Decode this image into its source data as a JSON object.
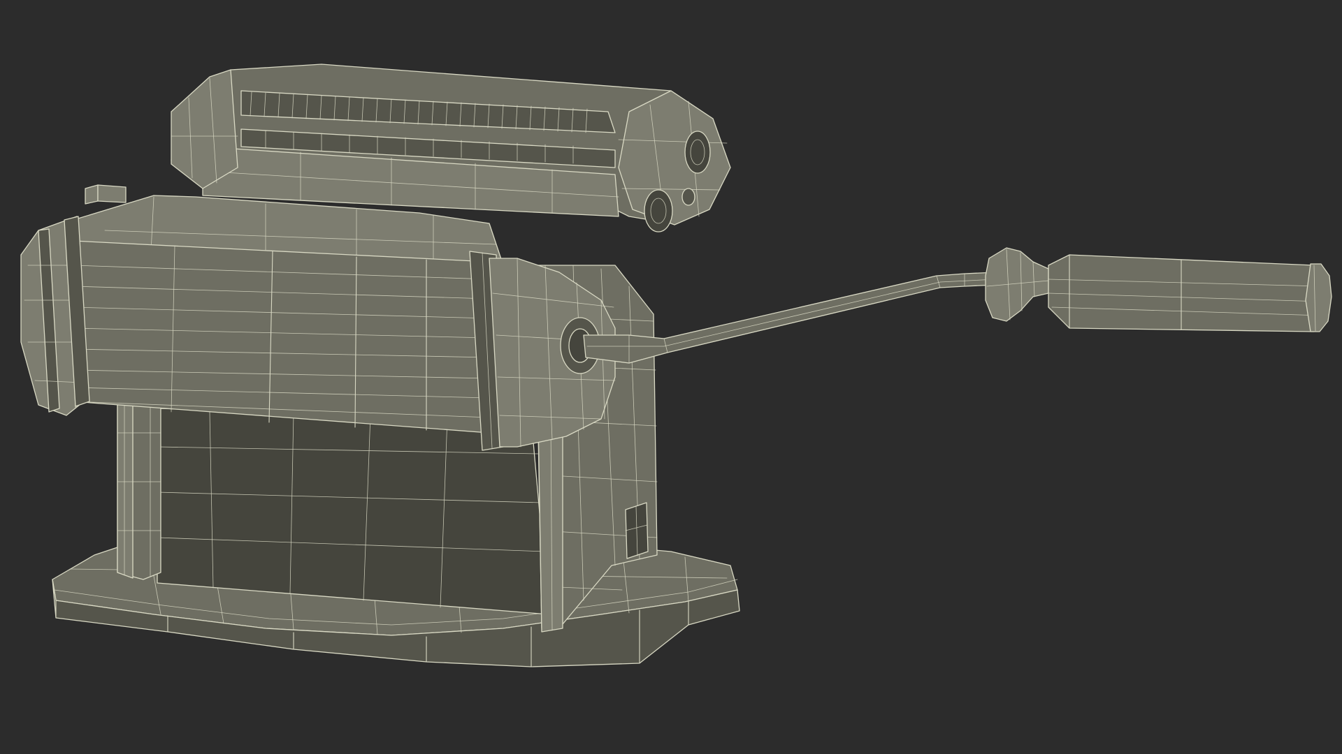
{
  "scene": {
    "subject": "pasta-machine-wireframe",
    "colors": {
      "background": "#2c2c2c",
      "surface": "#6e6e62",
      "surface_light": "#7d7d70",
      "surface_dark": "#55554b",
      "shadow": "#45453d",
      "wire": "#d9d9c4"
    }
  }
}
